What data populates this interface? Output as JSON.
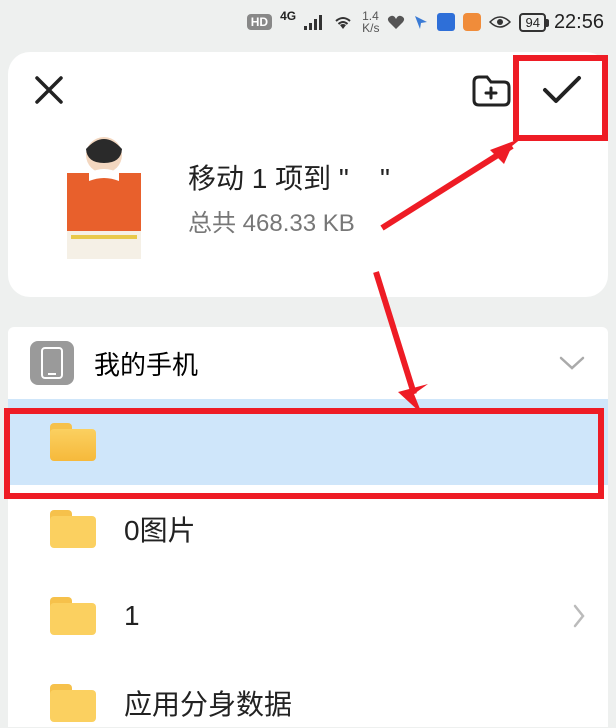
{
  "statusbar": {
    "hd": "HD",
    "net": "4G",
    "speed_top": "1.4",
    "speed_bot": "K/s",
    "battery": "94",
    "time": "22:56"
  },
  "header": {
    "title_prefix": "移动 1 项到 \"",
    "title_dest": "",
    "title_suffix": "\"",
    "subtitle": "总共 468.33 KB"
  },
  "phone_row": {
    "label": "我的手机"
  },
  "folders": [
    {
      "name": "",
      "selected": true,
      "open": true,
      "chevron": false
    },
    {
      "name": "0图片",
      "selected": false,
      "open": false,
      "chevron": false
    },
    {
      "name": "1",
      "selected": false,
      "open": false,
      "chevron": true
    },
    {
      "name": "应用分身数据",
      "selected": false,
      "open": false,
      "chevron": false
    }
  ]
}
